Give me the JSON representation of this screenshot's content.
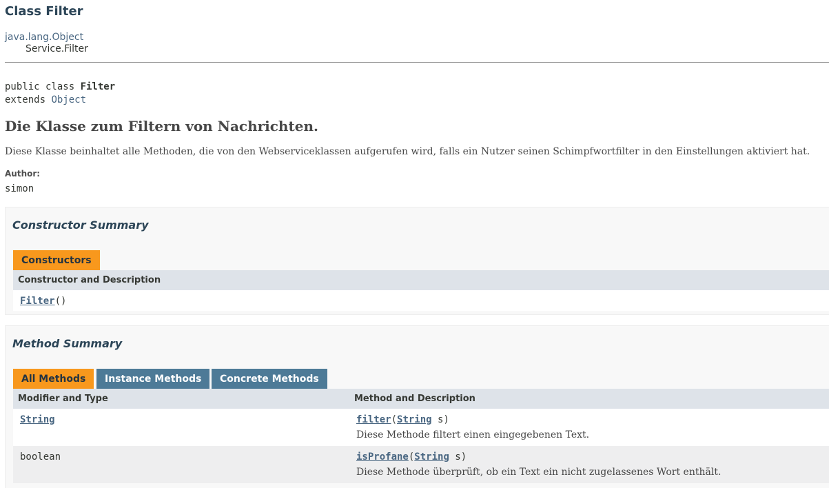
{
  "header": {
    "title": "Class Filter",
    "inheritance_root": "java.lang.Object",
    "inheritance_child": "Service.Filter"
  },
  "declaration": {
    "line1_prefix": "public class ",
    "class_name": "Filter",
    "line2_prefix": "extends ",
    "superclass": "Object"
  },
  "description": {
    "heading": "Die Klasse zum Filtern von Nachrichten.",
    "text": "Diese Klasse beinhaltet alle Methoden, die von den Webserviceklassen aufgerufen wird, falls ein Nutzer seinen Schimpfwortfilter in den Einstellungen aktiviert hat.",
    "author_label": "Author:",
    "author": "simon"
  },
  "constructor_summary": {
    "title": "Constructor Summary",
    "tab": "Constructors",
    "column": "Constructor and Description",
    "rows": [
      {
        "name": "Filter",
        "params": "()"
      }
    ]
  },
  "method_summary": {
    "title": "Method Summary",
    "tabs": [
      "All Methods",
      "Instance Methods",
      "Concrete Methods"
    ],
    "columns": [
      "Modifier and Type",
      "Method and Description"
    ],
    "rows": [
      {
        "type": "String",
        "method": "filter",
        "open": "(",
        "param_type": "String",
        "param_rest": " s)",
        "desc": "Diese Methode filtert einen eingegebenen Text."
      },
      {
        "type": "boolean",
        "method": "isProfane",
        "open": "(",
        "param_type": "String",
        "param_rest": " s)",
        "desc": "Diese Methode überprüft, ob ein Text ein nicht zugelassenes Wort enthält."
      }
    ]
  },
  "colors": {
    "active_tab": "#f8981d",
    "inactive_tab": "#4d7a97",
    "link": "#4a6782",
    "table_header": "#dee3e9"
  }
}
